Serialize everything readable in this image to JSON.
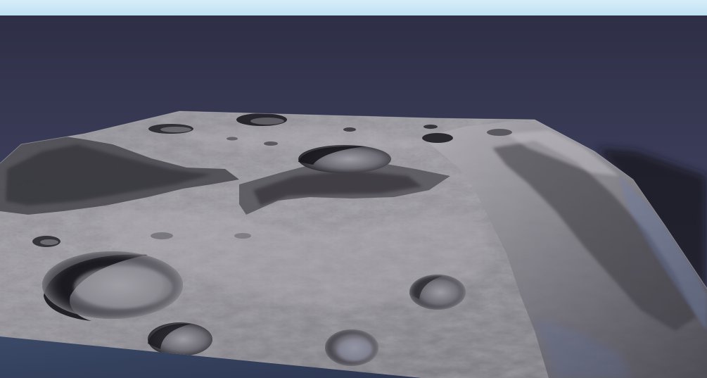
{
  "scene": {
    "kind": "3d-terrain-render",
    "subject": "cratered-lunar-heightmap",
    "colors": {
      "sky_band": "#cfe9f7",
      "backdrop_top": "#2e2f46",
      "backdrop_bottom": "#4e4f72",
      "terrain_light": "#a8a6ad",
      "terrain_mid": "#7c7a82",
      "terrain_dark": "#3d3b43",
      "crater_shadow": "#1e1d24",
      "ground_plane": "#3a4866",
      "blue_sheen": "#6c7fb0"
    }
  }
}
